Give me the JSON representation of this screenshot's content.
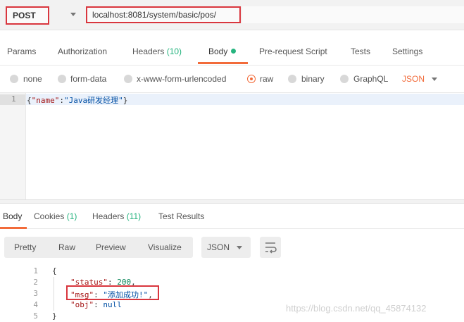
{
  "request": {
    "method": "POST",
    "url": "localhost:8081/system/basic/pos/"
  },
  "tabs": {
    "params": "Params",
    "authorization": "Authorization",
    "headers": "Headers",
    "headers_count": "(10)",
    "body": "Body",
    "prerequest": "Pre-request Script",
    "tests": "Tests",
    "settings": "Settings"
  },
  "body_types": {
    "none": "none",
    "form_data": "form-data",
    "urlencoded": "x-www-form-urlencoded",
    "raw": "raw",
    "binary": "binary",
    "graphql": "GraphQL",
    "format": "JSON",
    "selected": "raw"
  },
  "editor": {
    "line_number": "1",
    "open_brace": "{",
    "key": "\"name\"",
    "colon": ":",
    "value": "\"Java研发经理\"",
    "close_brace": "}"
  },
  "response_tabs": {
    "body": "Body",
    "cookies": "Cookies",
    "cookies_count": "(1)",
    "headers": "Headers",
    "headers_count": "(11)",
    "test_results": "Test Results"
  },
  "response_toolbar": {
    "pretty": "Pretty",
    "raw": "Raw",
    "preview": "Preview",
    "visualize": "Visualize",
    "format": "JSON"
  },
  "response_body": {
    "line_numbers": [
      "1",
      "2",
      "3",
      "4",
      "5"
    ],
    "open": "{",
    "status_key": "\"status\"",
    "status_value": "200",
    "msg_key": "\"msg\"",
    "msg_value": "\"添加成功!\"",
    "obj_key": "\"obj\"",
    "obj_value": "null",
    "close": "}"
  },
  "watermark": "https://blog.csdn.net/qq_45874132",
  "colors": {
    "accent": "#f26b3a",
    "highlight_box": "#d9363e",
    "count_green": "#26b47f"
  }
}
